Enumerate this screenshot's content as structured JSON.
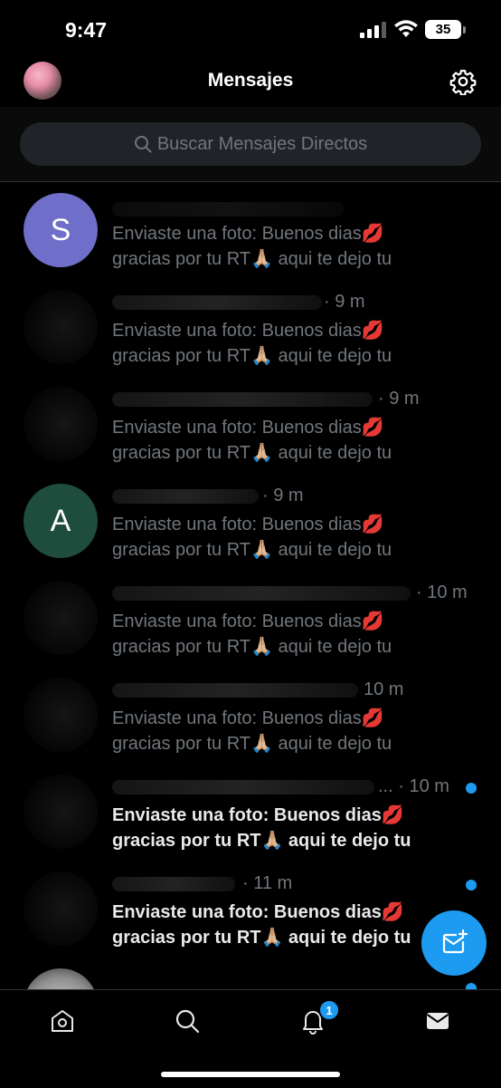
{
  "status": {
    "time": "9:47",
    "battery": "35"
  },
  "header": {
    "title": "Mensajes"
  },
  "search": {
    "placeholder": "Buscar Mensajes Directos"
  },
  "conversations": [
    {
      "initial": "S",
      "avatar_color": "#6f6ec8",
      "time": "",
      "line1": "Enviaste una foto: Buenos dias💋",
      "line2": "gracias por tu RT🙏🏼 aqui te dejo tu",
      "unread": false
    },
    {
      "initial": "",
      "avatar_color": "",
      "time": "· 9 m",
      "line1": "Enviaste una foto: Buenos dias💋",
      "line2": "gracias por tu RT🙏🏼 aqui te dejo tu",
      "unread": false
    },
    {
      "initial": "",
      "avatar_color": "",
      "time": "· 9 m",
      "line1": "Enviaste una foto: Buenos dias💋",
      "line2": "gracias por tu RT🙏🏼 aqui te dejo tu",
      "unread": false
    },
    {
      "initial": "A",
      "avatar_color": "#1f4d3d",
      "time": "· 9 m",
      "line1": "Enviaste una foto: Buenos dias💋",
      "line2": "gracias por tu RT🙏🏼 aqui te dejo tu",
      "unread": false
    },
    {
      "initial": "",
      "avatar_color": "",
      "time": "· 10 m",
      "line1": "Enviaste una foto: Buenos dias💋",
      "line2": "gracias por tu RT🙏🏼 aqui te dejo tu",
      "unread": false
    },
    {
      "initial": "",
      "avatar_color": "",
      "time": "10 m",
      "line1": "Enviaste una foto: Buenos dias💋",
      "line2": "gracias por tu RT🙏🏼 aqui te dejo tu",
      "unread": false
    },
    {
      "initial": "",
      "avatar_color": "",
      "time": "... · 10 m",
      "line1": "Enviaste una foto: Buenos dias💋",
      "line2": "gracias por tu RT🙏🏼 aqui te dejo tu",
      "unread": true
    },
    {
      "initial": "",
      "avatar_color": "",
      "time": "· 11 m",
      "line1": "Enviaste una foto: Buenos dias💋",
      "line2": "gracias por tu RT🙏🏼 aqui te dejo tu",
      "unread": true
    }
  ],
  "tabs": [
    {
      "icon": "home-icon"
    },
    {
      "icon": "search-icon"
    },
    {
      "icon": "notifications-icon",
      "badge": "1"
    },
    {
      "icon": "mail-icon"
    }
  ],
  "colors": {
    "accent": "#1d9bf0",
    "background": "#000000",
    "muted_text": "#71767b"
  }
}
